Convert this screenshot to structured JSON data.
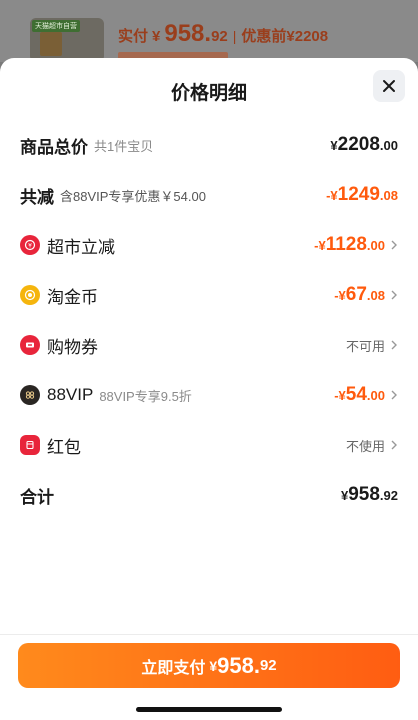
{
  "background": {
    "thumb_tag": "天猫超市自营",
    "paid_label": "实付",
    "paid_currency": "¥",
    "paid_int": "958.",
    "paid_dec": "92",
    "separator": "|",
    "original": "优惠前¥2208"
  },
  "sheet": {
    "title": "价格明细",
    "close_icon": "close-icon"
  },
  "rows": {
    "total": {
      "label": "商品总价",
      "sub": "共1件宝贝",
      "currency": "¥",
      "int": "2208",
      "dec": ".00"
    },
    "discount": {
      "label": "共减",
      "sub": "含88VIP专享优惠￥54.00",
      "currency": "-¥",
      "int": "1249",
      "dec": ".08"
    },
    "supermarket": {
      "label": "超市立减",
      "currency": "-¥",
      "int": "1128",
      "dec": ".00"
    },
    "coins": {
      "label": "淘金币",
      "currency": "-¥",
      "int": "67",
      "dec": ".08"
    },
    "coupon": {
      "label": "购物券",
      "status": "不可用"
    },
    "vip": {
      "label": "88VIP",
      "sub": "88VIP专享9.5折",
      "currency": "-¥",
      "int": "54",
      "dec": ".00"
    },
    "redpacket": {
      "label": "红包",
      "status": "不使用"
    },
    "sum": {
      "label": "合计",
      "currency": "¥",
      "int": "958",
      "dec": ".92"
    }
  },
  "footer": {
    "pay_label": "立即支付",
    "currency": "¥",
    "int": "958.",
    "dec": "92"
  },
  "colors": {
    "accent_orange": "#ff5a0d",
    "text_primary": "#1a1a1a",
    "icon_red": "#e8253b",
    "icon_gold": "#f5b50d"
  }
}
